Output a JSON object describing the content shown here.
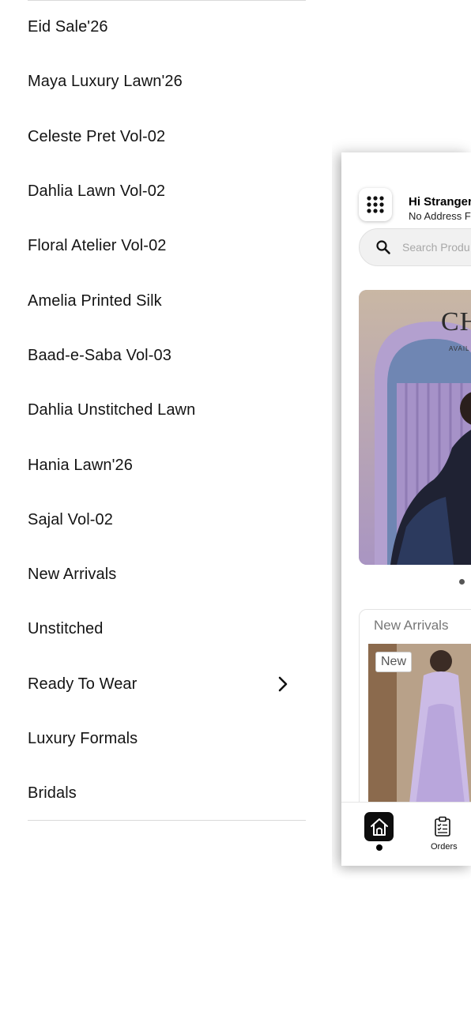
{
  "menu": {
    "items": [
      {
        "label": "Eid Sale'26"
      },
      {
        "label": "Maya Luxury Lawn'26"
      },
      {
        "label": "Celeste Pret Vol-02"
      },
      {
        "label": "Dahlia Lawn Vol-02"
      },
      {
        "label": "Floral Atelier Vol-02"
      },
      {
        "label": "Amelia Printed Silk"
      },
      {
        "label": "Baad-e-Saba Vol-03"
      },
      {
        "label": "Dahlia Unstitched Lawn"
      },
      {
        "label": "Hania Lawn'26"
      },
      {
        "label": "Sajal Vol-02"
      },
      {
        "label": "New Arrivals"
      },
      {
        "label": "Unstitched"
      },
      {
        "label": "Ready To Wear",
        "has_submenu": true,
        "submenu_icon": "chevron-right-icon"
      },
      {
        "label": "Luxury Formals"
      },
      {
        "label": "Bridals"
      }
    ]
  },
  "preview": {
    "menu_icon": "grid-dots-icon",
    "greeting": "Hi Stranger",
    "address": "No Address F",
    "search": {
      "icon": "search-icon",
      "placeholder": "Search Produ"
    },
    "banner": {
      "text": "CH",
      "subtext": "AVAIL"
    },
    "new_arrivals": {
      "title": "New Arrivals",
      "badge": "New"
    },
    "tabbar": {
      "home": {
        "icon": "home-icon",
        "active": true
      },
      "orders": {
        "icon": "clipboard-icon",
        "label": "Orders"
      }
    }
  },
  "colors": {
    "text": "#141414",
    "accent": "#0d0d0d",
    "divider": "#d9d9d9"
  }
}
